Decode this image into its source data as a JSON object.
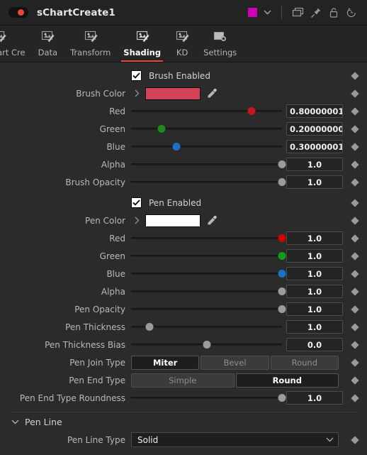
{
  "titlebar": {
    "node_name": "sChartCreate1",
    "power_icon": "power-toggle-icon",
    "color_chip": "#cc00b4",
    "chevron_icon": "chevron-down-icon",
    "icons": [
      "duplicate-icon",
      "pin-icon",
      "lock-icon",
      "reset-history-icon"
    ]
  },
  "tabs": [
    {
      "label": "oe Chart Cre",
      "icon": "magic-wand-icon",
      "active": false,
      "clipped": true
    },
    {
      "label": "Data",
      "icon": "magic-wand-icon",
      "active": false
    },
    {
      "label": "Transform",
      "icon": "magic-wand-icon",
      "active": false
    },
    {
      "label": "Shading",
      "icon": "magic-wand-icon",
      "active": true
    },
    {
      "label": "KD",
      "icon": "magic-wand-icon",
      "active": false
    },
    {
      "label": "Settings",
      "icon": "gear-panel-icon",
      "active": false
    }
  ],
  "accent": "#e8453c",
  "brush": {
    "enabled_label": "Brush Enabled",
    "enabled": true,
    "color_label": "Brush Color",
    "color_hex": "#d14358",
    "rows": [
      {
        "label": "Red",
        "value": "0.80000001",
        "pos": 80,
        "knob": "#c4161c"
      },
      {
        "label": "Green",
        "value": "0.20000000",
        "pos": 20,
        "knob": "#1f8a1f"
      },
      {
        "label": "Blue",
        "value": "0.30000001",
        "pos": 30,
        "knob": "#1f6fc4"
      },
      {
        "label": "Alpha",
        "value": "1.0",
        "pos": 100,
        "knob": "#9b9b9b"
      },
      {
        "label": "Brush Opacity",
        "value": "1.0",
        "pos": 100,
        "knob": "#9b9b9b"
      }
    ]
  },
  "pen": {
    "enabled_label": "Pen Enabled",
    "enabled": true,
    "color_label": "Pen Color",
    "color_hex": "#ffffff",
    "rows": [
      {
        "label": "Red",
        "value": "1.0",
        "pos": 100,
        "knob": "#d40000"
      },
      {
        "label": "Green",
        "value": "1.0",
        "pos": 100,
        "knob": "#12a012"
      },
      {
        "label": "Blue",
        "value": "1.0",
        "pos": 100,
        "knob": "#1673cc"
      },
      {
        "label": "Alpha",
        "value": "1.0",
        "pos": 100,
        "knob": "#9b9b9b"
      },
      {
        "label": "Pen Opacity",
        "value": "1.0",
        "pos": 100,
        "knob": "#9b9b9b"
      },
      {
        "label": "Pen Thickness",
        "value": "1.0",
        "pos": 12,
        "knob": "#9b9b9b"
      },
      {
        "label": "Pen Thickness Bias",
        "value": "0.0",
        "pos": 50,
        "knob": "#9b9b9b"
      }
    ],
    "join_type": {
      "label": "Pen Join Type",
      "options": [
        "Miter",
        "Bevel",
        "Round"
      ],
      "selected": "Miter"
    },
    "end_type": {
      "label": "Pen End Type",
      "options": [
        "Simple",
        "Round"
      ],
      "selected": "Round"
    },
    "end_roundness": {
      "label": "Pen End Type Roundness",
      "value": "1.0",
      "pos": 100,
      "knob": "#9b9b9b"
    }
  },
  "pen_line_section": {
    "title": "Pen Line",
    "expanded": true,
    "chevron_icon": "chevron-down-icon",
    "line_type": {
      "label": "Pen Line Type",
      "value": "Solid",
      "chevron_icon": "chevron-down-icon"
    }
  }
}
